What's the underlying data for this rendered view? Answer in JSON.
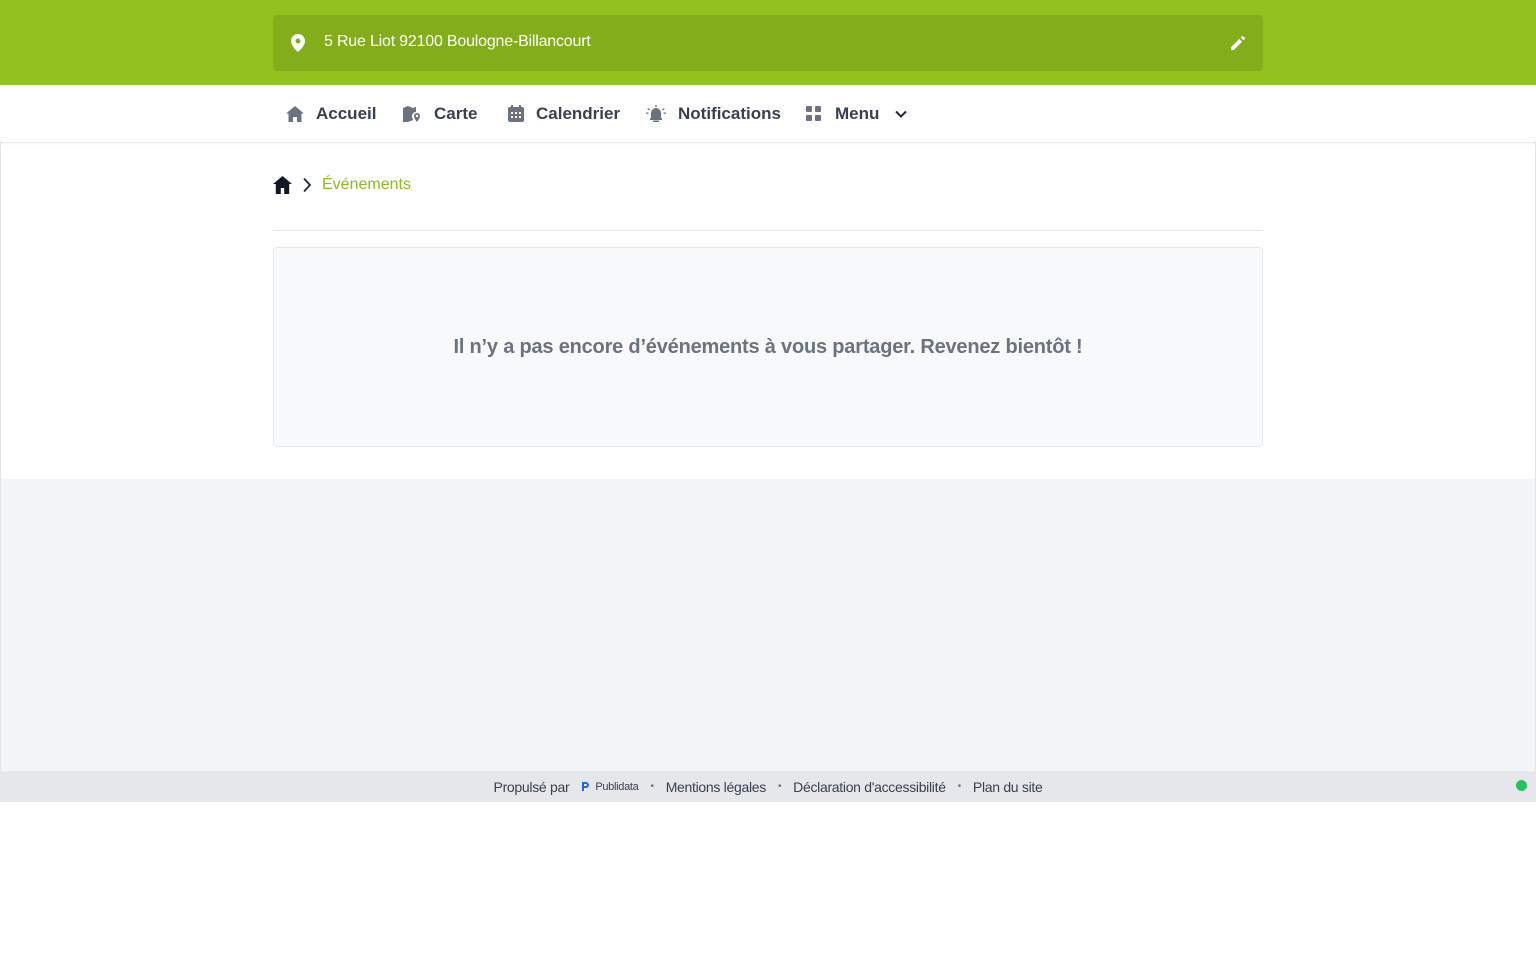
{
  "header": {
    "address": "5 Rue Liot 92100 Boulogne-Billancourt",
    "pin_icon": "location-pin-icon",
    "edit_icon": "pencil-icon",
    "bg_color": "#93c21f"
  },
  "nav": {
    "items": [
      {
        "label": "Accueil",
        "icon": "home-icon"
      },
      {
        "label": "Carte",
        "icon": "map-icon"
      },
      {
        "label": "Calendrier",
        "icon": "calendar-icon"
      },
      {
        "label": "Notifications",
        "icon": "alarm-icon"
      },
      {
        "label": "Menu",
        "icon": "grid-icon"
      }
    ]
  },
  "breadcrumb": {
    "current": "Événements"
  },
  "main": {
    "empty_message": "Il n’y a pas encore d’événements à vous partager. Revenez bientôt !"
  },
  "footer": {
    "powered_by": "Propulsé par",
    "brand": "Publidata",
    "links": [
      "Mentions légales",
      "Déclaration d'accessibilité",
      "Plan du site"
    ],
    "separator": "•",
    "status_color": "#22c55e"
  }
}
